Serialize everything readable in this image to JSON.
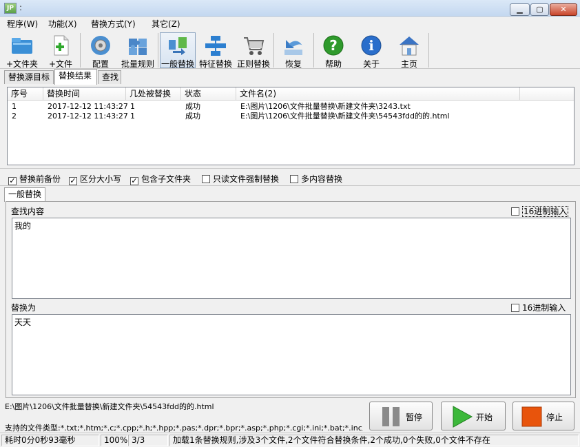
{
  "window": {
    "title": ":",
    "min": "▁",
    "max": "▢",
    "close": "✕"
  },
  "menu": [
    "程序(W)",
    "功能(X)",
    "替换方式(Y)",
    "其它(Z)"
  ],
  "toolbar": [
    {
      "label": "+文件夹"
    },
    {
      "label": "+文件"
    },
    {
      "label": "配置"
    },
    {
      "label": "批量规则"
    },
    {
      "label": "一般替换"
    },
    {
      "label": "特征替换"
    },
    {
      "label": "正则替换"
    },
    {
      "label": "恢复"
    },
    {
      "label": "帮助"
    },
    {
      "label": "关于"
    },
    {
      "label": "主页"
    }
  ],
  "tabs": [
    "替换源目标",
    "替换结果",
    "查找"
  ],
  "list": {
    "columns": [
      "序号",
      "替换时间",
      "几处被替换",
      "状态",
      "文件名(2)"
    ],
    "rows": [
      {
        "no": "1",
        "time": "2017-12-12 11:43:27",
        "count": "1",
        "status": "成功",
        "file": "E:\\图片\\1206\\文件批量替换\\新建文件夹\\3243.txt"
      },
      {
        "no": "2",
        "time": "2017-12-12 11:43:27",
        "count": "1",
        "status": "成功",
        "file": "E:\\图片\\1206\\文件批量替换\\新建文件夹\\54543fdd的的.html"
      }
    ]
  },
  "options": [
    {
      "label": "替换前备份",
      "checked": true
    },
    {
      "label": "区分大小写",
      "checked": true
    },
    {
      "label": "包含子文件夹",
      "checked": true
    },
    {
      "label": "只读文件强制替换",
      "checked": false
    },
    {
      "label": "多内容替换",
      "checked": false
    }
  ],
  "lower_tab": "一般替换",
  "find": {
    "label": "查找内容",
    "hex_label": "16进制输入",
    "value": "我的"
  },
  "replace": {
    "label": "替换为",
    "hex_label": "16进制输入",
    "value": "天天"
  },
  "current_path": "E:\\图片\\1206\\文件批量替换\\新建文件夹\\54543fdd的的.html",
  "file_types": "支持的文件类型:*.txt;*.htm;*.c;*.cpp;*.h;*.hpp;*.pas;*.dpr;*.bpr;*.asp;*.php;*.cgi;*.ini;*.bat;*.inc;*.java;*.py;*.dfm",
  "buttons": {
    "pause": "暂停",
    "start": "开始",
    "stop": "停止"
  },
  "status": {
    "elapsed": "耗时0分0秒93毫秒",
    "progress": "100%",
    "count": "3/3",
    "message": "加载1条替换规则,涉及3个文件,2个文件符合替换条件,2个成功,0个失败,0个文件不存在"
  },
  "colors": {
    "start_green": "#3cb83a",
    "stop_orange": "#e8540c",
    "help_green": "#2f9a2c",
    "about_blue": "#2a6ecb"
  }
}
